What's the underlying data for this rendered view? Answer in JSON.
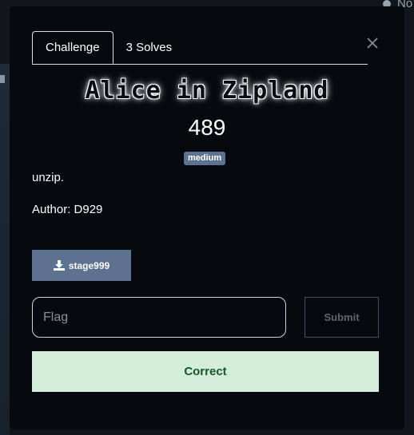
{
  "background": {
    "user_label": "No"
  },
  "tabs": [
    {
      "label": "Challenge",
      "active": true
    },
    {
      "label": "3 Solves",
      "active": false
    }
  ],
  "close_icon": "close-icon",
  "challenge": {
    "title": "Alice in Zipland",
    "points": "489",
    "difficulty": "medium",
    "description": "unzip.",
    "author": "Author: D929"
  },
  "file": {
    "label": "stage999",
    "icon": "download-icon"
  },
  "flag_input": {
    "placeholder": "Flag",
    "value": ""
  },
  "submit_label": "Submit",
  "result_message": "Correct",
  "colors": {
    "accent": "#5c7290",
    "modal_bg": "#060a0e",
    "success_bg": "#d4edda",
    "success_text": "#155724"
  }
}
